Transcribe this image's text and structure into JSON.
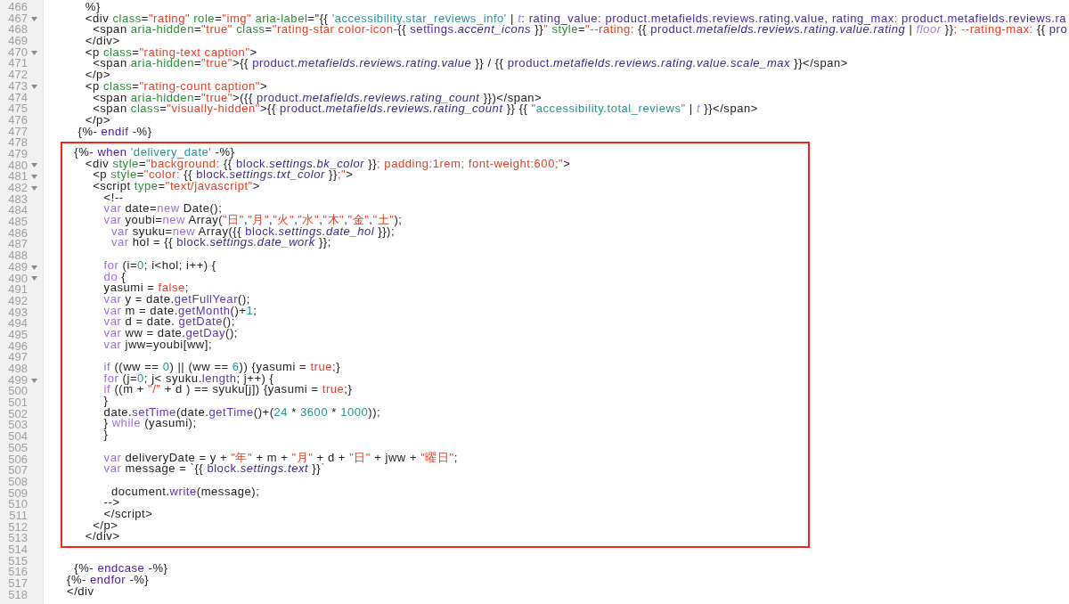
{
  "before": [
    {
      "number": "466",
      "foldable": false,
      "tokens": [
        {
          "kind": "plain",
          "text": "     %}"
        }
      ]
    },
    {
      "number": "467",
      "foldable": true,
      "tokens": [
        {
          "kind": "plain",
          "text": "     <div "
        },
        {
          "kind": "attr",
          "text": "class"
        },
        {
          "kind": "plain",
          "text": "="
        },
        {
          "kind": "string",
          "text": "\"rating\""
        },
        {
          "kind": "attr",
          "text": " role"
        },
        {
          "kind": "plain",
          "text": "="
        },
        {
          "kind": "string",
          "text": "\"img\""
        },
        {
          "kind": "attr",
          "text": " aria-label"
        },
        {
          "kind": "plain",
          "text": "=\"{{ "
        },
        {
          "kind": "liquid",
          "text": "'accessibility.star_reviews_info'"
        },
        {
          "kind": "plain",
          "text": " | "
        },
        {
          "kind": "filter",
          "text": "t"
        },
        {
          "kind": "plain",
          "text": ": "
        },
        {
          "kind": "object",
          "text": "rating_value: product.metafields.reviews.rating.value, rating_max: product.metafields.reviews.ra"
        }
      ]
    },
    {
      "number": "468",
      "foldable": false,
      "tokens": [
        {
          "kind": "plain",
          "text": "       <span "
        },
        {
          "kind": "attr",
          "text": "aria-hidden"
        },
        {
          "kind": "plain",
          "text": "="
        },
        {
          "kind": "string",
          "text": "\"true\""
        },
        {
          "kind": "attr",
          "text": " class"
        },
        {
          "kind": "plain",
          "text": "="
        },
        {
          "kind": "string",
          "text": "\"rating-star color-icon-"
        },
        {
          "kind": "plain",
          "text": "{{ "
        },
        {
          "kind": "object",
          "text": "settings."
        },
        {
          "kind": "property",
          "text": "accent_icons"
        },
        {
          "kind": "plain",
          "text": " }}"
        },
        {
          "kind": "string",
          "text": "\""
        },
        {
          "kind": "attr",
          "text": " style"
        },
        {
          "kind": "plain",
          "text": "="
        },
        {
          "kind": "string",
          "text": "\"--rating: "
        },
        {
          "kind": "plain",
          "text": "{{ "
        },
        {
          "kind": "object",
          "text": "product."
        },
        {
          "kind": "property",
          "text": "metafields.reviews.rating.value.rating"
        },
        {
          "kind": "plain",
          "text": " | "
        },
        {
          "kind": "filter",
          "text": "floor"
        },
        {
          "kind": "plain",
          "text": " }}"
        },
        {
          "kind": "string",
          "text": "; --rating-max: "
        },
        {
          "kind": "plain",
          "text": "{{ "
        },
        {
          "kind": "object",
          "text": "pro"
        }
      ]
    },
    {
      "number": "469",
      "foldable": false,
      "tokens": [
        {
          "kind": "plain",
          "text": "     </div>"
        }
      ]
    },
    {
      "number": "470",
      "foldable": true,
      "tokens": [
        {
          "kind": "plain",
          "text": "     <p "
        },
        {
          "kind": "attr",
          "text": "class"
        },
        {
          "kind": "plain",
          "text": "="
        },
        {
          "kind": "string",
          "text": "\"rating-text caption\""
        },
        {
          "kind": "plain",
          "text": ">"
        }
      ]
    },
    {
      "number": "471",
      "foldable": false,
      "tokens": [
        {
          "kind": "plain",
          "text": "       <span "
        },
        {
          "kind": "attr",
          "text": "aria-hidden"
        },
        {
          "kind": "plain",
          "text": "="
        },
        {
          "kind": "string",
          "text": "\"true\""
        },
        {
          "kind": "plain",
          "text": ">{{ "
        },
        {
          "kind": "object",
          "text": "product."
        },
        {
          "kind": "property",
          "text": "metafields.reviews.rating.value"
        },
        {
          "kind": "plain",
          "text": " }} / {{ "
        },
        {
          "kind": "object",
          "text": "product."
        },
        {
          "kind": "property",
          "text": "metafields.reviews.rating.value.scale_max"
        },
        {
          "kind": "plain",
          "text": " }}</span>"
        }
      ]
    },
    {
      "number": "472",
      "foldable": false,
      "tokens": [
        {
          "kind": "plain",
          "text": "     </p>"
        }
      ]
    },
    {
      "number": "473",
      "foldable": true,
      "tokens": [
        {
          "kind": "plain",
          "text": "     <p "
        },
        {
          "kind": "attr",
          "text": "class"
        },
        {
          "kind": "plain",
          "text": "="
        },
        {
          "kind": "string",
          "text": "\"rating-count caption\""
        },
        {
          "kind": "plain",
          "text": ">"
        }
      ]
    },
    {
      "number": "474",
      "foldable": false,
      "tokens": [
        {
          "kind": "plain",
          "text": "       <span "
        },
        {
          "kind": "attr",
          "text": "aria-hidden"
        },
        {
          "kind": "plain",
          "text": "="
        },
        {
          "kind": "string",
          "text": "\"true\""
        },
        {
          "kind": "plain",
          "text": ">({{ "
        },
        {
          "kind": "object",
          "text": "product."
        },
        {
          "kind": "property",
          "text": "metafields.reviews.rating_count"
        },
        {
          "kind": "plain",
          "text": " }})</span>"
        }
      ]
    },
    {
      "number": "475",
      "foldable": false,
      "tokens": [
        {
          "kind": "plain",
          "text": "       <span "
        },
        {
          "kind": "attr",
          "text": "class"
        },
        {
          "kind": "plain",
          "text": "="
        },
        {
          "kind": "string",
          "text": "\"visually-hidden\""
        },
        {
          "kind": "plain",
          "text": ">{{ "
        },
        {
          "kind": "object",
          "text": "product."
        },
        {
          "kind": "property",
          "text": "metafields.reviews.rating_count"
        },
        {
          "kind": "plain",
          "text": " }} {{ "
        },
        {
          "kind": "liquid",
          "text": "\"accessibility.total_reviews\""
        },
        {
          "kind": "plain",
          "text": " | "
        },
        {
          "kind": "filter",
          "text": "t"
        },
        {
          "kind": "plain",
          "text": " }}</span>"
        }
      ]
    },
    {
      "number": "476",
      "foldable": false,
      "tokens": [
        {
          "kind": "plain",
          "text": "     </p>"
        }
      ]
    },
    {
      "number": "477",
      "foldable": false,
      "tokens": [
        {
          "kind": "plain",
          "text": "   {%- "
        },
        {
          "kind": "tag",
          "text": "endif"
        },
        {
          "kind": "plain",
          "text": " -%}"
        }
      ]
    },
    {
      "number": "478",
      "foldable": false
    }
  ],
  "highlight_box": [
    {
      "number": "479",
      "foldable": false,
      "tokens": [
        {
          "kind": "plain",
          "text": "  {%- "
        },
        {
          "kind": "tag",
          "text": "when"
        },
        {
          "kind": "liquid",
          "text": " 'delivery_date'"
        },
        {
          "kind": "plain",
          "text": " -%}"
        }
      ]
    },
    {
      "number": "480",
      "foldable": true,
      "tokens": [
        {
          "kind": "plain",
          "text": "     <div "
        },
        {
          "kind": "attr",
          "text": "style"
        },
        {
          "kind": "plain",
          "text": "="
        },
        {
          "kind": "string",
          "text": "\"background: "
        },
        {
          "kind": "plain",
          "text": "{{ "
        },
        {
          "kind": "object",
          "text": "block."
        },
        {
          "kind": "property",
          "text": "settings.bk_color"
        },
        {
          "kind": "plain",
          "text": " }}"
        },
        {
          "kind": "string",
          "text": "; padding:1rem; font-weight:600;\""
        },
        {
          "kind": "plain",
          "text": ">"
        }
      ]
    },
    {
      "number": "481",
      "foldable": true,
      "tokens": [
        {
          "kind": "plain",
          "text": "       <p "
        },
        {
          "kind": "attr",
          "text": "style"
        },
        {
          "kind": "plain",
          "text": "="
        },
        {
          "kind": "string",
          "text": "\"color: "
        },
        {
          "kind": "plain",
          "text": "{{ "
        },
        {
          "kind": "object",
          "text": "block."
        },
        {
          "kind": "property",
          "text": "settings.txt_color"
        },
        {
          "kind": "plain",
          "text": " }}"
        },
        {
          "kind": "string",
          "text": ";\""
        },
        {
          "kind": "plain",
          "text": ">"
        }
      ]
    },
    {
      "number": "482",
      "foldable": true,
      "tokens": [
        {
          "kind": "plain",
          "text": "       <script "
        },
        {
          "kind": "attr",
          "text": "type"
        },
        {
          "kind": "plain",
          "text": "="
        },
        {
          "kind": "string",
          "text": "\"text/javascript\""
        },
        {
          "kind": "plain",
          "text": ">"
        }
      ]
    },
    {
      "number": "483",
      "foldable": false,
      "tokens": [
        {
          "kind": "plain",
          "text": "          <!--"
        }
      ]
    },
    {
      "number": "484",
      "foldable": false,
      "tokens": [
        {
          "kind": "keyword",
          "text": "          var"
        },
        {
          "kind": "plain",
          "text": " date="
        },
        {
          "kind": "keyword",
          "text": "new"
        },
        {
          "kind": "plain",
          "text": " Date();"
        }
      ]
    },
    {
      "number": "485",
      "foldable": false,
      "tokens": [
        {
          "kind": "keyword",
          "text": "          var"
        },
        {
          "kind": "plain",
          "text": " youbi="
        },
        {
          "kind": "keyword",
          "text": "new"
        },
        {
          "kind": "plain",
          "text": " Array("
        },
        {
          "kind": "string",
          "text": "\"日\""
        },
        {
          "kind": "plain",
          "text": ","
        },
        {
          "kind": "string",
          "text": "\"月\""
        },
        {
          "kind": "plain",
          "text": ","
        },
        {
          "kind": "string",
          "text": "\"火\""
        },
        {
          "kind": "plain",
          "text": ","
        },
        {
          "kind": "string",
          "text": "\"水\""
        },
        {
          "kind": "plain",
          "text": ","
        },
        {
          "kind": "string",
          "text": "\"木\""
        },
        {
          "kind": "plain",
          "text": ","
        },
        {
          "kind": "string",
          "text": "\"金\""
        },
        {
          "kind": "plain",
          "text": ","
        },
        {
          "kind": "string",
          "text": "\"土\""
        },
        {
          "kind": "plain",
          "text": ");"
        }
      ]
    },
    {
      "number": "486",
      "foldable": false,
      "tokens": [
        {
          "kind": "keyword",
          "text": "            var"
        },
        {
          "kind": "plain",
          "text": " syuku="
        },
        {
          "kind": "keyword",
          "text": "new"
        },
        {
          "kind": "plain",
          "text": " Array({{ "
        },
        {
          "kind": "object",
          "text": "block."
        },
        {
          "kind": "property",
          "text": "settings.date_hol"
        },
        {
          "kind": "plain",
          "text": " }});"
        }
      ]
    },
    {
      "number": "487",
      "foldable": false,
      "tokens": [
        {
          "kind": "keyword",
          "text": "            var"
        },
        {
          "kind": "plain",
          "text": " hol = {{ "
        },
        {
          "kind": "object",
          "text": "block."
        },
        {
          "kind": "property",
          "text": "settings.date_work"
        },
        {
          "kind": "plain",
          "text": " }};"
        }
      ]
    },
    {
      "number": "488",
      "foldable": false
    },
    {
      "number": "489",
      "foldable": true,
      "tokens": [
        {
          "kind": "keyword",
          "text": "          for"
        },
        {
          "kind": "plain",
          "text": " (i="
        },
        {
          "kind": "number",
          "text": "0"
        },
        {
          "kind": "plain",
          "text": "; i<hol; i++) {"
        }
      ]
    },
    {
      "number": "490",
      "foldable": true,
      "tokens": [
        {
          "kind": "keyword",
          "text": "          do"
        },
        {
          "kind": "plain",
          "text": " {"
        }
      ]
    },
    {
      "number": "491",
      "foldable": false,
      "tokens": [
        {
          "kind": "plain",
          "text": "          yasumi = "
        },
        {
          "kind": "string",
          "text": "false"
        },
        {
          "kind": "plain",
          "text": ";"
        }
      ]
    },
    {
      "number": "492",
      "foldable": false,
      "tokens": [
        {
          "kind": "keyword",
          "text": "          var"
        },
        {
          "kind": "plain",
          "text": " y = date."
        },
        {
          "kind": "method",
          "text": "getFullYear"
        },
        {
          "kind": "plain",
          "text": "();"
        }
      ]
    },
    {
      "number": "493",
      "foldable": false,
      "tokens": [
        {
          "kind": "keyword",
          "text": "          var"
        },
        {
          "kind": "plain",
          "text": " m = date."
        },
        {
          "kind": "method",
          "text": "getMonth"
        },
        {
          "kind": "plain",
          "text": "()+"
        },
        {
          "kind": "number",
          "text": "1"
        },
        {
          "kind": "plain",
          "text": ";"
        }
      ]
    },
    {
      "number": "494",
      "foldable": false,
      "tokens": [
        {
          "kind": "keyword",
          "text": "          var"
        },
        {
          "kind": "plain",
          "text": " d = date. "
        },
        {
          "kind": "method",
          "text": "getDate"
        },
        {
          "kind": "plain",
          "text": "();"
        }
      ]
    },
    {
      "number": "495",
      "foldable": false,
      "tokens": [
        {
          "kind": "keyword",
          "text": "          var"
        },
        {
          "kind": "plain",
          "text": " ww = date."
        },
        {
          "kind": "method",
          "text": "getDay"
        },
        {
          "kind": "plain",
          "text": "();"
        }
      ]
    },
    {
      "number": "496",
      "foldable": false,
      "tokens": [
        {
          "kind": "keyword",
          "text": "          var"
        },
        {
          "kind": "plain",
          "text": " jww=youbi[ww];"
        }
      ]
    },
    {
      "number": "497",
      "foldable": false
    },
    {
      "number": "498",
      "foldable": false,
      "tokens": [
        {
          "kind": "keyword",
          "text": "          if"
        },
        {
          "kind": "plain",
          "text": " ((ww == "
        },
        {
          "kind": "number",
          "text": "0"
        },
        {
          "kind": "plain",
          "text": ") || (ww == "
        },
        {
          "kind": "number",
          "text": "6"
        },
        {
          "kind": "plain",
          "text": ")) {yasumi = "
        },
        {
          "kind": "string",
          "text": "true"
        },
        {
          "kind": "plain",
          "text": ";}"
        }
      ]
    },
    {
      "number": "499",
      "foldable": true,
      "tokens": [
        {
          "kind": "keyword",
          "text": "          for"
        },
        {
          "kind": "plain",
          "text": " (j="
        },
        {
          "kind": "number",
          "text": "0"
        },
        {
          "kind": "plain",
          "text": "; j< syuku."
        },
        {
          "kind": "method",
          "text": "length"
        },
        {
          "kind": "plain",
          "text": "; j++) {"
        }
      ]
    },
    {
      "number": "500",
      "foldable": false,
      "tokens": [
        {
          "kind": "keyword",
          "text": "          if"
        },
        {
          "kind": "plain",
          "text": " ((m + "
        },
        {
          "kind": "string",
          "text": "\"/\""
        },
        {
          "kind": "plain",
          "text": " + d ) == syuku[j]) {yasumi = "
        },
        {
          "kind": "string",
          "text": "true"
        },
        {
          "kind": "plain",
          "text": ";}"
        }
      ]
    },
    {
      "number": "501",
      "foldable": false,
      "tokens": [
        {
          "kind": "plain",
          "text": "          }"
        }
      ]
    },
    {
      "number": "502",
      "foldable": false,
      "tokens": [
        {
          "kind": "plain",
          "text": "          date."
        },
        {
          "kind": "method",
          "text": "setTime"
        },
        {
          "kind": "plain",
          "text": "(date."
        },
        {
          "kind": "method",
          "text": "getTime"
        },
        {
          "kind": "plain",
          "text": "()+("
        },
        {
          "kind": "number",
          "text": "24"
        },
        {
          "kind": "plain",
          "text": " * "
        },
        {
          "kind": "number",
          "text": "3600"
        },
        {
          "kind": "plain",
          "text": " * "
        },
        {
          "kind": "number",
          "text": "1000"
        },
        {
          "kind": "plain",
          "text": "));"
        }
      ]
    },
    {
      "number": "503",
      "foldable": false,
      "tokens": [
        {
          "kind": "plain",
          "text": "          } "
        },
        {
          "kind": "keyword",
          "text": "while"
        },
        {
          "kind": "plain",
          "text": " (yasumi);"
        }
      ]
    },
    {
      "number": "504",
      "foldable": false,
      "tokens": [
        {
          "kind": "plain",
          "text": "          }"
        }
      ]
    },
    {
      "number": "505",
      "foldable": false
    },
    {
      "number": "506",
      "foldable": false,
      "tokens": [
        {
          "kind": "keyword",
          "text": "          var"
        },
        {
          "kind": "plain",
          "text": " deliveryDate = y + "
        },
        {
          "kind": "string",
          "text": "\"年\""
        },
        {
          "kind": "plain",
          "text": " + m + "
        },
        {
          "kind": "string",
          "text": "\"月\""
        },
        {
          "kind": "plain",
          "text": " + d + "
        },
        {
          "kind": "string",
          "text": "\"日\""
        },
        {
          "kind": "plain",
          "text": " + jww + "
        },
        {
          "kind": "string",
          "text": "\"曜日\""
        },
        {
          "kind": "plain",
          "text": ";"
        }
      ]
    },
    {
      "number": "507",
      "foldable": false,
      "tokens": [
        {
          "kind": "keyword",
          "text": "          var"
        },
        {
          "kind": "plain",
          "text": " message = `{{ "
        },
        {
          "kind": "object",
          "text": "block."
        },
        {
          "kind": "property",
          "text": "settings.text"
        },
        {
          "kind": "plain",
          "text": " }}"
        },
        {
          "kind": "string",
          "text": "`"
        }
      ]
    },
    {
      "number": "508",
      "foldable": false
    },
    {
      "number": "509",
      "foldable": false,
      "tokens": [
        {
          "kind": "plain",
          "text": "            document."
        },
        {
          "kind": "method",
          "text": "write"
        },
        {
          "kind": "plain",
          "text": "(message);"
        }
      ]
    },
    {
      "number": "510",
      "foldable": false,
      "tokens": [
        {
          "kind": "plain",
          "text": "          -->"
        }
      ]
    },
    {
      "number": "511",
      "foldable": false,
      "tokens": [
        {
          "kind": "plain",
          "text": "          </script>"
        }
      ]
    },
    {
      "number": "512",
      "foldable": false,
      "tokens": [
        {
          "kind": "plain",
          "text": "       </p>"
        }
      ]
    },
    {
      "number": "513",
      "foldable": false,
      "tokens": [
        {
          "kind": "plain",
          "text": "     </div>"
        }
      ]
    }
  ],
  "after": [
    {
      "number": "514",
      "foldable": false
    },
    {
      "number": "515",
      "foldable": false
    },
    {
      "number": "516",
      "foldable": false,
      "tokens": [
        {
          "kind": "plain",
          "text": "  {%- "
        },
        {
          "kind": "tag",
          "text": "endcase"
        },
        {
          "kind": "plain",
          "text": " -%}"
        }
      ]
    },
    {
      "number": "517",
      "foldable": false,
      "tokens": [
        {
          "kind": "plain",
          "text": "{%- "
        },
        {
          "kind": "tag",
          "text": "endfor"
        },
        {
          "kind": "plain",
          "text": " -%}"
        }
      ]
    },
    {
      "number": "518",
      "foldable": false,
      "tokens": [
        {
          "kind": "plain",
          "text": "</div"
        }
      ]
    }
  ]
}
